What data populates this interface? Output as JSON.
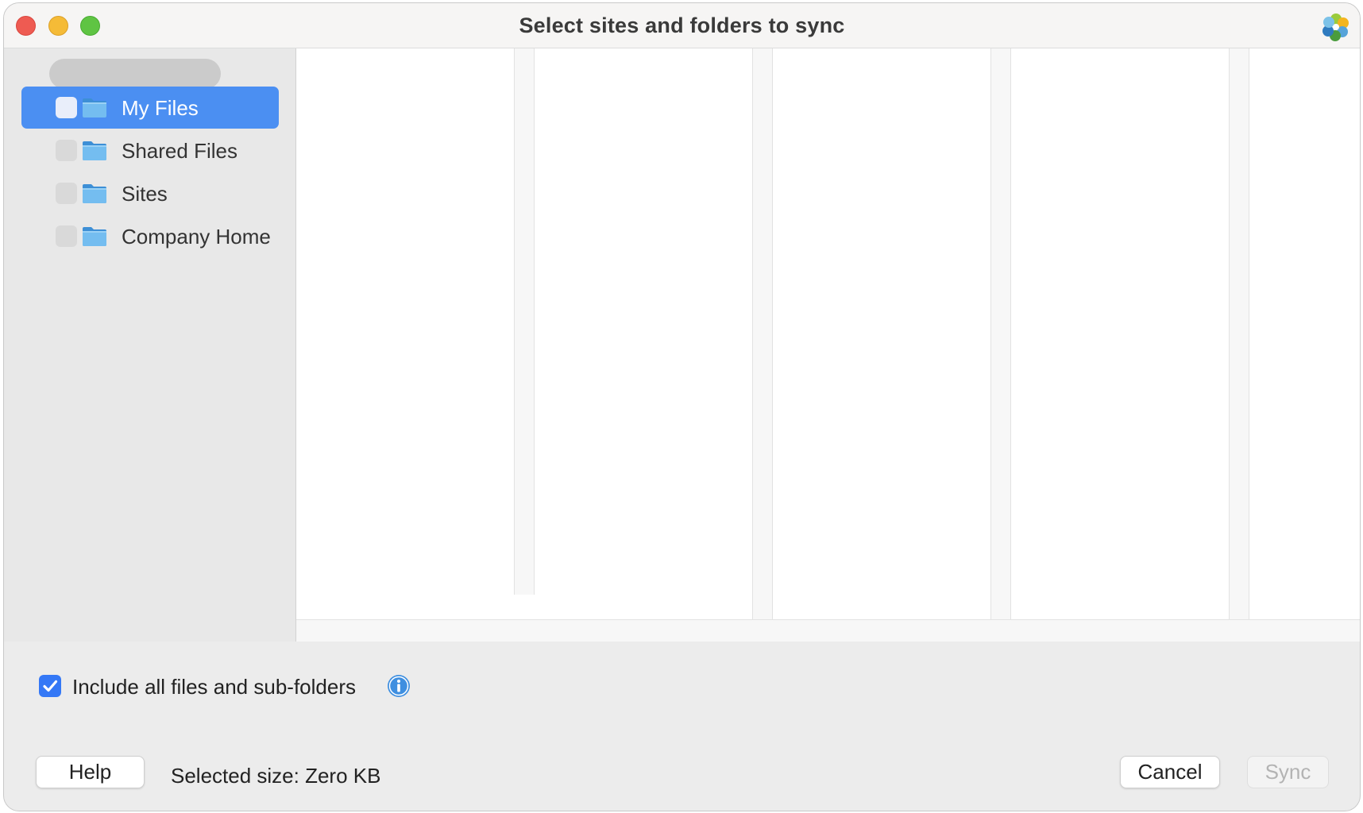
{
  "window": {
    "title": "Select sites and folders to sync"
  },
  "sidebar": {
    "items": [
      {
        "label": "My Files",
        "selected": true,
        "icon": "folder-icon"
      },
      {
        "label": "Shared Files",
        "selected": false,
        "icon": "folder-icon"
      },
      {
        "label": "Sites",
        "selected": false,
        "icon": "folder-icon"
      },
      {
        "label": "Company Home",
        "selected": false,
        "icon": "folder-icon"
      }
    ]
  },
  "options": {
    "include_all_label": "Include all files and sub-folders",
    "include_all_checked": true,
    "info_icon": "info-icon"
  },
  "footer": {
    "help_label": "Help",
    "selected_size": "Selected size: Zero KB",
    "cancel_label": "Cancel",
    "sync_label": "Sync",
    "sync_enabled": false
  },
  "colors": {
    "accent": "#4b8ff2",
    "checkbox": "#3478f6",
    "folder": "#5aa9e6",
    "close": "#ee5b52",
    "minimize": "#f5bb37",
    "zoom": "#5fc443"
  }
}
